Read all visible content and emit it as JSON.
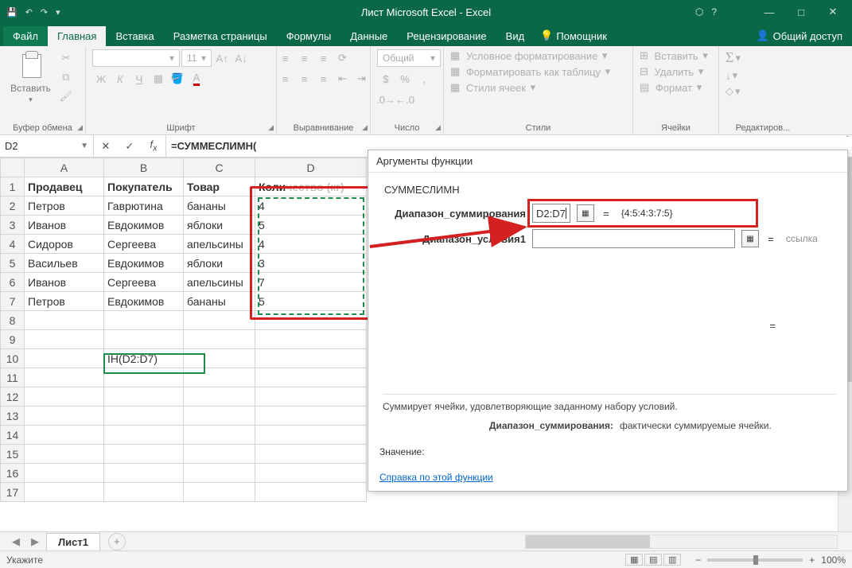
{
  "title": "Лист Microsoft Excel - Excel",
  "tabs": {
    "file": "Файл",
    "home": "Главная",
    "insert": "Вставка",
    "layout": "Разметка страницы",
    "formulas": "Формулы",
    "data": "Данные",
    "review": "Рецензирование",
    "view": "Вид",
    "helper": "Помощник",
    "share": "Общий доступ"
  },
  "ribbon": {
    "paste": "Вставить",
    "clipboard": "Буфер обмена",
    "font": "Шрифт",
    "fontsize": "11",
    "align": "Выравнивание",
    "number": "Число",
    "numfmt": "Общий",
    "styles": "Стили",
    "condfmt": "Условное форматирование",
    "fmttable": "Форматировать как таблицу",
    "cellstyles": "Стили ячеек",
    "cells": "Ячейки",
    "insertc": "Вставить",
    "deletec": "Удалить",
    "formatc": "Формат",
    "editing": "Редактиров..."
  },
  "namebox": "D2",
  "formula": "=СУММЕСЛИМН(",
  "columns": [
    "A",
    "B",
    "C",
    "D"
  ],
  "headers": [
    "Продавец",
    "Покупатель",
    "Товар",
    "Количество (кг)"
  ],
  "rows": [
    {
      "a": "Петров",
      "b": "Гаврютина",
      "c": "бананы",
      "d": "4"
    },
    {
      "a": "Иванов",
      "b": "Евдокимов",
      "c": "яблоки",
      "d": "5"
    },
    {
      "a": "Сидоров",
      "b": "Сергеева",
      "c": "апельсины",
      "d": "4"
    },
    {
      "a": "Васильев",
      "b": "Евдокимов",
      "c": "яблоки",
      "d": "3"
    },
    {
      "a": "Иванов",
      "b": "Сергеева",
      "c": "апельсины",
      "d": "7"
    },
    {
      "a": "Петров",
      "b": "Евдокимов",
      "c": "бананы",
      "d": "5"
    }
  ],
  "b10": "ІН(D2:D7)",
  "sheet": "Лист1",
  "status": "Укажите",
  "zoom": "100%",
  "dialog": {
    "title": "Аргументы функции",
    "func": "СУММЕСЛИМН",
    "arg1label": "Диапазон_суммирования",
    "arg1value": "D2:D7",
    "arg1result": "{4:5:4:3:7:5}",
    "arg2label": "Диапазон_условия1",
    "arg2value": "",
    "arg2result": "ссылка",
    "eq": "=",
    "desc": "Суммирует ячейки, удовлетворяющие заданному набору условий.",
    "helparg": "Диапазон_суммирования:",
    "helptext": "фактически суммируемые ячейки.",
    "valuelabel": "Значение:",
    "helplink": "Справка по этой функции"
  },
  "chart_data": {
    "type": "table",
    "title": "",
    "columns": [
      "Продавец",
      "Покупатель",
      "Товар",
      "Количество (кг)"
    ],
    "rows": [
      [
        "Петров",
        "Гаврютина",
        "бананы",
        4
      ],
      [
        "Иванов",
        "Евдокимов",
        "яблоки",
        5
      ],
      [
        "Сидоров",
        "Сергеева",
        "апельсины",
        4
      ],
      [
        "Васильев",
        "Евдокимов",
        "яблоки",
        3
      ],
      [
        "Иванов",
        "Сергеева",
        "апельсины",
        7
      ],
      [
        "Петров",
        "Евдокимов",
        "бананы",
        5
      ]
    ]
  }
}
